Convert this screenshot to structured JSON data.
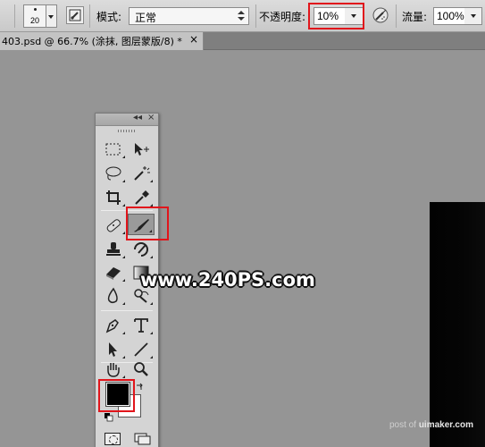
{
  "options_bar": {
    "brush_size": "20",
    "mode_label": "模式:",
    "mode_value": "正常",
    "opacity_label": "不透明度:",
    "opacity_value": "10%",
    "flow_label": "流量:",
    "flow_value": "100%"
  },
  "document_tab": {
    "title": "403.psd @ 66.7% (涂抹, 图层蒙版/8) *",
    "close_label": "×"
  },
  "tools_panel": {
    "collapse_label": "◂◂",
    "close_label": "×",
    "foreground_color": "#000000",
    "background_color": "#ffffff",
    "active_tool": "brush-tool"
  },
  "watermark": {
    "text": "www.240PS.com"
  },
  "credit": {
    "prefix": "post of ",
    "site": "uimaker.com"
  },
  "colors": {
    "highlight_red": "#e1151b",
    "workspace_gray": "#959595"
  }
}
